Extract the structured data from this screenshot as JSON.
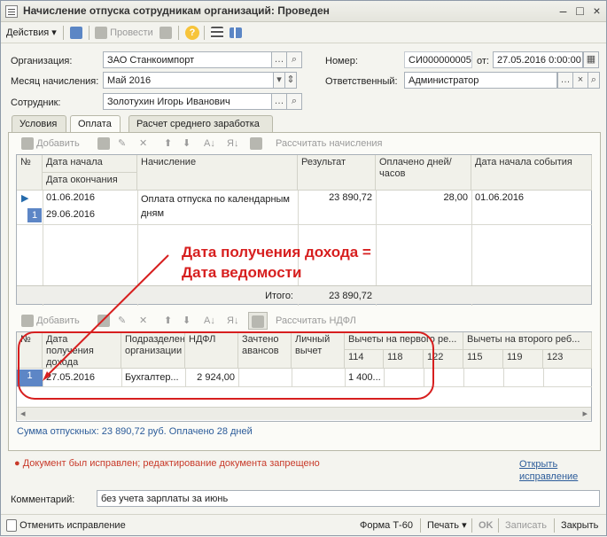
{
  "window": {
    "title": "Начисление отпуска сотрудникам организаций: Проведен",
    "minimize_icon": "minimize-icon",
    "maximize_icon": "maximize-icon",
    "close_icon": "close-icon"
  },
  "toolbar": {
    "actions_label": "Действия",
    "post_label": "Провести"
  },
  "form": {
    "organization_label": "Организация:",
    "organization_value": "ЗАО Станкоимпорт",
    "number_label": "Номер:",
    "number_value": "СИ000000005",
    "from_label": "от:",
    "date_value": "27.05.2016 0:00:00",
    "month_label": "Месяц начисления:",
    "month_value": "Май 2016",
    "responsible_label": "Ответственный:",
    "responsible_value": "Администратор",
    "employee_label": "Сотрудник:",
    "employee_value": "Золотухин Игорь Иванович"
  },
  "tabs": [
    "Условия",
    "Оплата",
    "Расчет среднего заработка"
  ],
  "payment": {
    "add_label": "Добавить",
    "calculate_label": "Рассчитать начисления",
    "headers": {
      "num": "№",
      "start_date": "Дата начала",
      "end_date": "Дата окончания",
      "accrual": "Начисление",
      "result": "Результат",
      "paid_days": "Оплачено дней/часов",
      "event_start": "Дата начала события"
    },
    "row": {
      "num": "1",
      "start_date": "01.06.2016",
      "end_date": "29.06.2016",
      "accrual_line1": "Оплата отпуска по календарным",
      "accrual_line2": "дням",
      "result": "23 890,72",
      "paid_days": "28,00",
      "event_start": "01.06.2016"
    },
    "total_label": "Итого:",
    "total_value": "23 890,72"
  },
  "annotation": {
    "line1": "Дата получения дохода =",
    "line2": "Дата ведомости"
  },
  "ndfl": {
    "add_label": "Добавить",
    "calculate_label": "Рассчитать НДФЛ",
    "headers": {
      "num": "№",
      "income_date": "Дата получения дохода",
      "department": "Подразделение организации",
      "ndfl": "НДФЛ",
      "advances": "Зачтено авансов",
      "personal": "Личный вычет",
      "deductions_first": "Вычеты на первого ре...",
      "deductions_second": "Вычеты на второго реб...",
      "c114": "114",
      "c118": "118",
      "c122": "122",
      "c115": "115",
      "c119": "119",
      "c123": "123"
    },
    "row": {
      "num": "1",
      "income_date": "27.05.2016",
      "department": "Бухгалтер...",
      "ndfl": "2 924,00",
      "c114": "1 400..."
    }
  },
  "summary": "Сумма отпускных: 23 890,72 руб. Оплачено 28 дней",
  "warning": "Документ был исправлен; редактирование документа запрещено",
  "open_correction": "Открыть исправление",
  "comment_label": "Комментарий:",
  "comment_value": "без учета зарплаты за июнь",
  "bottom": {
    "cancel_correction": "Отменить исправление",
    "form_label": "Форма Т-60",
    "print_label": "Печать",
    "ok_label": "OK",
    "save_label": "Записать",
    "close_label": "Закрыть"
  },
  "colors": {
    "accent": "#5d86c6",
    "annotation_red": "#d71f1f",
    "link_blue": "#2c5c9a"
  }
}
